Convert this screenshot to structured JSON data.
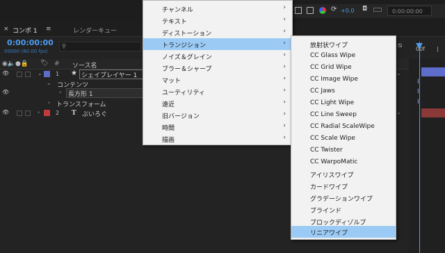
{
  "topbar": {
    "time_display": "0:00:00:00",
    "value": "+0.0"
  },
  "tabs": {
    "comp_tab": "コンポ 1",
    "render_queue": "レンダーキュー"
  },
  "timecode": {
    "current": "0:00:00:00",
    "fps": "00000 (60.00 fps)"
  },
  "columns": {
    "source_name": "ソース名",
    "hash": "#"
  },
  "ruler": {
    "label": "00f"
  },
  "layers": [
    {
      "num": "1",
      "name": "シェイプレイヤー 1",
      "color": "#5e6ccc",
      "icon": "star-icon"
    },
    {
      "name": "コンテンツ"
    },
    {
      "name": "長方形 1"
    },
    {
      "name": "トランスフォーム"
    },
    {
      "num": "2",
      "name": "ぷいろぐ",
      "color": "#c23b3b",
      "icon": "text-T-icon",
      "type_glyph": "T"
    }
  ],
  "effects_menu": [
    {
      "label": "チャンネル",
      "has_sub": true
    },
    {
      "label": "テキスト",
      "has_sub": true
    },
    {
      "label": "ディストーション",
      "has_sub": true
    },
    {
      "label": "トランジション",
      "has_sub": true,
      "highlighted": true
    },
    {
      "label": "ノイズ＆グレイン",
      "has_sub": true
    },
    {
      "label": "ブラー＆シャープ",
      "has_sub": true
    },
    {
      "label": "マット",
      "has_sub": true
    },
    {
      "label": "ユーティリティ",
      "has_sub": true
    },
    {
      "label": "遠近",
      "has_sub": true
    },
    {
      "label": "旧バージョン",
      "has_sub": true
    },
    {
      "label": "時間",
      "has_sub": true
    },
    {
      "label": "描画",
      "has_sub": true
    }
  ],
  "transition_submenu": [
    {
      "label": "放射状ワイプ"
    },
    {
      "label": "CC Glass Wipe"
    },
    {
      "label": "CC Grid Wipe"
    },
    {
      "label": "CC Image Wipe"
    },
    {
      "label": "CC Jaws"
    },
    {
      "label": "CC Light Wipe"
    },
    {
      "label": "CC Line Sweep"
    },
    {
      "label": "CC Radial ScaleWipe"
    },
    {
      "label": "CC Scale Wipe"
    },
    {
      "label": "CC Twister"
    },
    {
      "label": "CC WarpoMatic"
    },
    {
      "label": "アイリスワイプ"
    },
    {
      "label": "カードワイプ"
    },
    {
      "label": "グラデーションワイプ"
    },
    {
      "label": "ブラインド"
    },
    {
      "label": "ブロックディゾルブ"
    },
    {
      "label": "リニアワイプ",
      "highlighted": true
    }
  ],
  "colors": {
    "accent": "#4e9cf0",
    "menu_highlight": "#9bcbf5",
    "layer1": "#5e6ccc",
    "layer2": "#c23b3b"
  }
}
